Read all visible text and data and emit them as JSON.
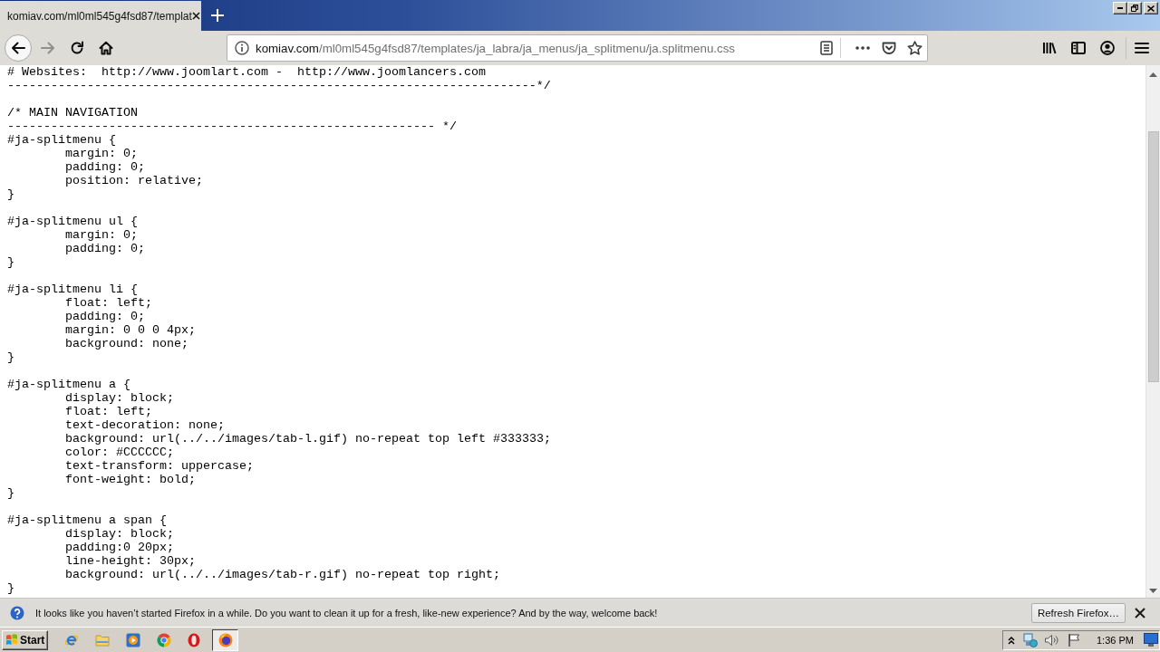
{
  "tabs": [
    {
      "title": "komiav.com/ml0ml545g4fsd87/templat",
      "selected": true
    }
  ],
  "nav_buttons": [
    {
      "kind": "back",
      "disabled": false
    },
    {
      "kind": "forward",
      "disabled": true
    },
    {
      "kind": "reload",
      "disabled": false
    },
    {
      "kind": "home",
      "disabled": false
    }
  ],
  "address_bar": {
    "host": "komiav.com",
    "path": "/ml0ml545g4fsd87/templates/ja_labra/ja_menus/ja_splitmenu/ja.splitmenu.css"
  },
  "code_sections": [
    [
      {
        "kind": "line",
        "text": "# Websites:  http://www.joomlart.com -  http://www.joomlancers.com"
      },
      {
        "kind": "line",
        "text": "-------------------------------------------------------------------------*/"
      }
    ],
    [
      {
        "kind": "line",
        "text": "/* MAIN NAVIGATION"
      },
      {
        "kind": "line",
        "text": "----------------------------------------------------------- */"
      },
      {
        "kind": "rule",
        "selector": "#ja-splitmenu {",
        "declarations": [
          "margin: 0;",
          "padding: 0;",
          "position: relative;"
        ],
        "close": "}"
      }
    ],
    [
      {
        "kind": "rule",
        "selector": "#ja-splitmenu ul {",
        "declarations": [
          "margin: 0;",
          "padding: 0;"
        ],
        "close": "}"
      }
    ],
    [
      {
        "kind": "rule",
        "selector": "#ja-splitmenu li {",
        "declarations": [
          "float: left;",
          "padding: 0;",
          "margin: 0 0 0 4px;",
          "background: none;"
        ],
        "close": "}"
      }
    ],
    [
      {
        "kind": "rule",
        "selector": "#ja-splitmenu a {",
        "declarations": [
          "display: block;",
          "float: left;",
          "text-decoration: none;",
          "background: url(../../images/tab-l.gif) no-repeat top left #333333;",
          "color: #CCCCCC;",
          "text-transform: uppercase;",
          "font-weight: bold;"
        ],
        "close": "}"
      }
    ],
    [
      {
        "kind": "rule",
        "selector": "#ja-splitmenu a span {",
        "declarations": [
          "display: block;",
          "padding:0 20px;",
          "line-height: 30px;",
          "background: url(../../images/tab-r.gif) no-repeat top right;"
        ],
        "close": "}"
      }
    ]
  ],
  "notification": {
    "message": "It looks like you haven’t started Firefox in a while. Do you want to clean it up for a fresh, like-new experience? And by the way, welcome back!",
    "button": "Refresh Firefox…"
  },
  "taskbar": {
    "start": "Start",
    "windows": [
      {
        "selected": true
      }
    ],
    "clock": "1:36 PM"
  }
}
